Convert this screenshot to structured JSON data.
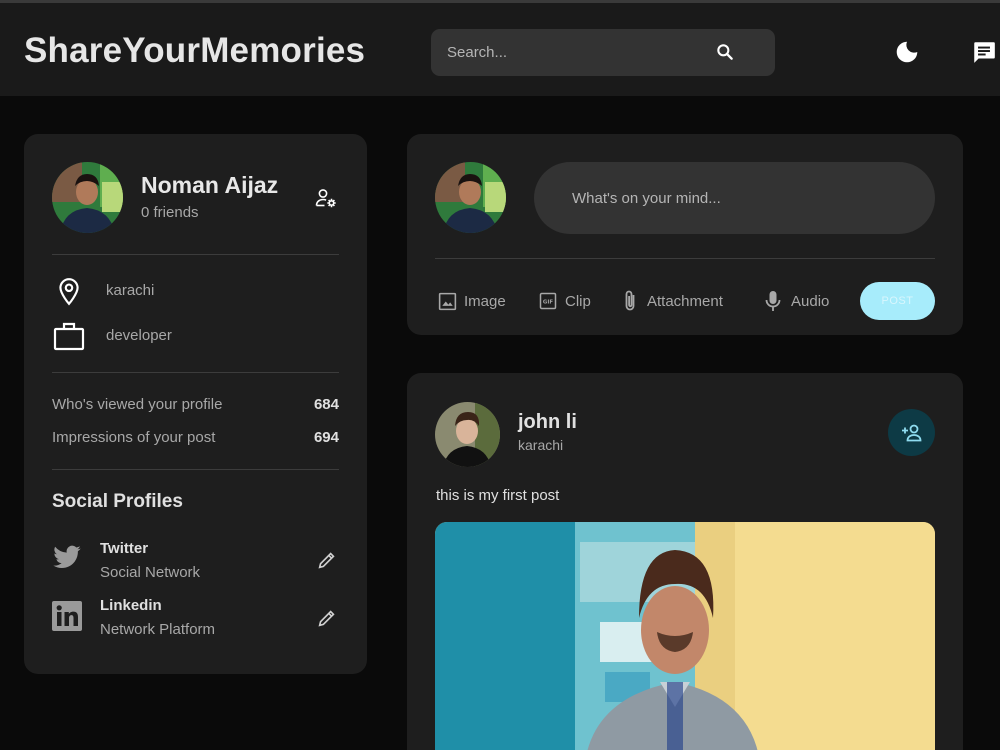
{
  "navbar": {
    "brand": "ShareYourMemories",
    "search_placeholder": "Search...",
    "icons": [
      "search-icon",
      "dark-mode-moon-icon",
      "message-icon"
    ]
  },
  "profile": {
    "name": "Noman Aijaz",
    "friends": "0 friends",
    "location": "karachi",
    "occupation": "developer",
    "stats": [
      {
        "label": "Who's viewed your profile",
        "value": "684"
      },
      {
        "label": "Impressions of your post",
        "value": "694"
      }
    ],
    "social_title": "Social Profiles",
    "social": [
      {
        "name": "Twitter",
        "type": "Social Network",
        "icon": "twitter-icon"
      },
      {
        "name": "Linkedin",
        "type": "Network Platform",
        "icon": "linkedin-icon"
      }
    ]
  },
  "composer": {
    "placeholder": "What's on your mind...",
    "actions": [
      {
        "label": "Image",
        "icon": "image-icon"
      },
      {
        "label": "Clip",
        "icon": "gif-icon"
      },
      {
        "label": "Attachment",
        "icon": "attachment-icon"
      },
      {
        "label": "Audio",
        "icon": "microphone-icon"
      }
    ],
    "post_label": "POST"
  },
  "post": {
    "author": "john li",
    "location": "karachi",
    "text": "this is my first post"
  },
  "colors": {
    "background": "#0a0a0a",
    "card": "#1e1e1e",
    "navbar": "#1a1a1a",
    "input": "#333333",
    "accent": "#a7ecfb",
    "add_friend_bg": "#0d3a45",
    "add_friend_icon": "#8fdcf0"
  }
}
